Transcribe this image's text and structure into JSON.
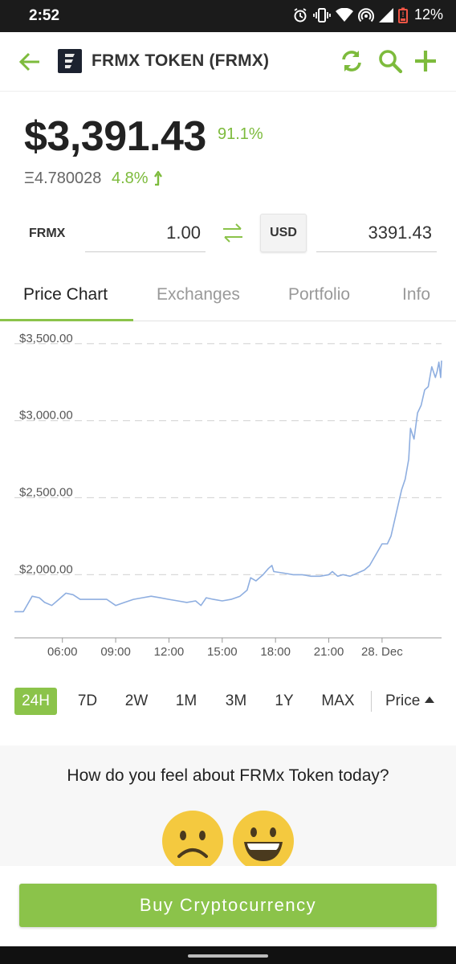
{
  "status_bar": {
    "time": "2:52",
    "battery_percent": "12%",
    "icons": [
      "alarm-icon",
      "vibrate-icon",
      "wifi-icon",
      "hotspot-icon",
      "signal-icon",
      "battery-icon"
    ]
  },
  "app_bar": {
    "title": "FRMX TOKEN (FRMX)",
    "back_icon": "back-arrow-icon",
    "actions": [
      "refresh-icon",
      "search-icon",
      "add-icon"
    ],
    "accent": "#7dbb3c"
  },
  "price": {
    "usd": "$3,391.43",
    "usd_change": "91.1%",
    "eth": "Ξ4.780028",
    "eth_change": "4.8%",
    "change_color": "#7dbb3c"
  },
  "converter": {
    "from_label": "FRMX",
    "from_value": "1.00",
    "to_label": "USD",
    "to_value": "3391.43"
  },
  "tabs": [
    "Price Chart",
    "Exchanges",
    "Portfolio",
    "Info"
  ],
  "active_tab": "Price Chart",
  "chart_data": {
    "type": "line",
    "title": "",
    "xlabel": "",
    "ylabel": "",
    "x_ticks": [
      "06:00",
      "09:00",
      "12:00",
      "15:00",
      "18:00",
      "21:00",
      "28. Dec"
    ],
    "y_ticks": [
      "$3,500.00",
      "$3,000.00",
      "$2,500.00",
      "$2,000.00"
    ],
    "y_tick_values": [
      3500,
      3000,
      2500,
      2000
    ],
    "ylim": [
      1590,
      3530
    ],
    "x_hours": [
      3.3,
      3.8,
      4.3,
      4.7,
      5.0,
      5.4,
      5.8,
      6.2,
      6.6,
      7.0,
      7.5,
      8.0,
      8.5,
      9.0,
      9.5,
      10.0,
      10.5,
      11.0,
      11.5,
      12.0,
      12.5,
      13.0,
      13.5,
      13.8,
      14.1,
      14.5,
      15.0,
      15.5,
      16.0,
      16.4,
      16.6,
      16.9,
      17.3,
      17.6,
      17.8,
      17.9,
      18.5,
      19.0,
      19.5,
      20.0,
      20.5,
      21.0,
      21.2,
      21.5,
      21.8,
      22.2,
      22.6,
      23.0,
      23.3,
      23.7,
      24.0,
      24.3,
      24.5,
      24.7,
      24.9,
      25.1,
      25.3,
      25.5,
      25.6,
      25.8,
      26.0,
      26.2,
      26.4,
      26.6,
      26.8,
      27.0,
      27.1,
      27.2,
      27.3,
      27.35
    ],
    "series": [
      {
        "color": "#8eaee0",
        "values": [
          1760,
          1760,
          1860,
          1850,
          1820,
          1800,
          1840,
          1880,
          1870,
          1840,
          1840,
          1840,
          1840,
          1800,
          1820,
          1840,
          1850,
          1860,
          1850,
          1840,
          1830,
          1820,
          1830,
          1800,
          1850,
          1840,
          1830,
          1840,
          1860,
          1900,
          1980,
          1960,
          2000,
          2040,
          2060,
          2020,
          2010,
          2000,
          2000,
          1990,
          1990,
          2000,
          2020,
          1990,
          2000,
          1990,
          2010,
          2030,
          2060,
          2140,
          2200,
          2200,
          2250,
          2350,
          2450,
          2550,
          2620,
          2750,
          2950,
          2880,
          3050,
          3100,
          3200,
          3220,
          3350,
          3280,
          3320,
          3380,
          3280,
          3390
        ]
      }
    ],
    "grid": "horizontal-dashed"
  },
  "ranges": [
    "24H",
    "7D",
    "2W",
    "1M",
    "3M",
    "1Y",
    "MAX"
  ],
  "active_range": "24H",
  "sort_label": "Price",
  "sentiment": {
    "question": "How do you feel about FRMx Token today?",
    "options": [
      "sad-face-icon",
      "happy-face-icon"
    ]
  },
  "buy_button": "Buy Cryptocurrency"
}
